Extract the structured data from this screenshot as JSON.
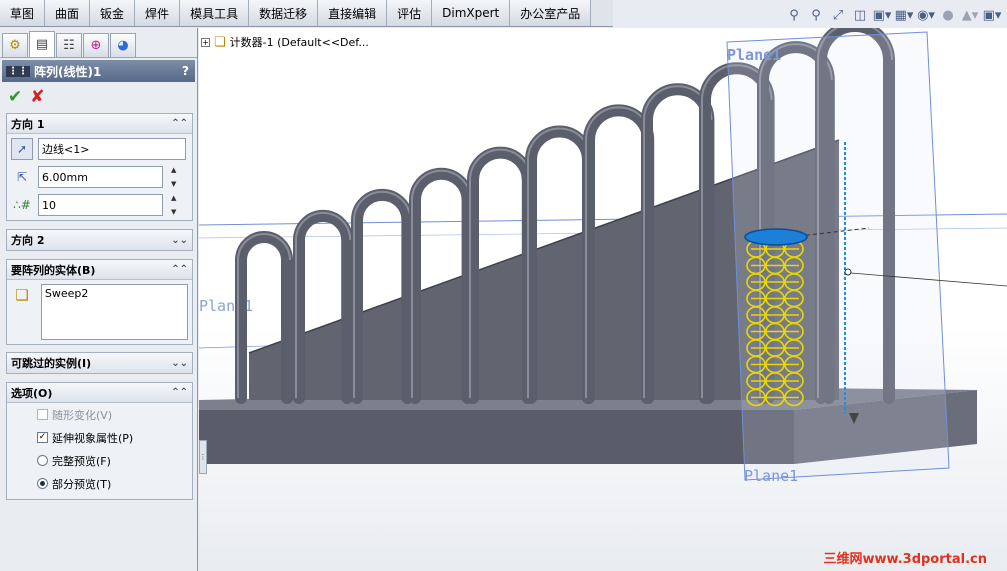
{
  "tabs": [
    "草图",
    "曲面",
    "钣金",
    "焊件",
    "模具工具",
    "数据迁移",
    "直接编辑",
    "评估",
    "DimXpert",
    "办公室产品"
  ],
  "view_toolbar": {
    "icons": [
      "zoom-to-fit-icon",
      "zoom-area-icon",
      "previous-view-icon",
      "section-view-icon",
      "view-orientation-icon",
      "display-style-icon",
      "hide-show-icon",
      "edit-appearance-icon",
      "apply-scene-icon",
      "view-settings-icon"
    ]
  },
  "panel": {
    "tab_icons": [
      "feature-manager-icon",
      "property-manager-icon",
      "configuration-manager-icon",
      "dimxpert-manager-icon",
      "display-manager-icon"
    ],
    "title": "阵列(线性)1",
    "help": "?",
    "direction1": {
      "header": "方向 1",
      "edge_value": "边线<1>",
      "distance_value": "6.00mm",
      "count_value": "10"
    },
    "direction2": {
      "header": "方向 2"
    },
    "bodies": {
      "header": "要阵列的实体(B)",
      "items": [
        "Sweep2"
      ]
    },
    "skip": {
      "header": "可跳过的实例(I)"
    },
    "options": {
      "header": "选项(O)",
      "items": [
        {
          "label": "随形变化(V)",
          "type": "checkbox",
          "checked": false,
          "enabled": false
        },
        {
          "label": "延伸视象属性(P)",
          "type": "checkbox",
          "checked": true,
          "enabled": true
        },
        {
          "label": "完整预览(F)",
          "type": "radio",
          "checked": false,
          "enabled": true
        },
        {
          "label": "部分预览(T)",
          "type": "radio",
          "checked": true,
          "enabled": true
        }
      ]
    }
  },
  "viewport": {
    "tree_label": "计数器-1  (Default<<Def...",
    "plane_label_right": "Plane1",
    "plane_label_left": "Plane1",
    "plane_label_bottom": "Plane1",
    "watermark": "三维网www.3dportal.cn"
  },
  "colors": {
    "steel": "#5b5e6b",
    "steel_light": "#8a8d99",
    "highlight": "#1d8ee6",
    "preview": "#e8d800",
    "plane": "#6f8fd8"
  }
}
